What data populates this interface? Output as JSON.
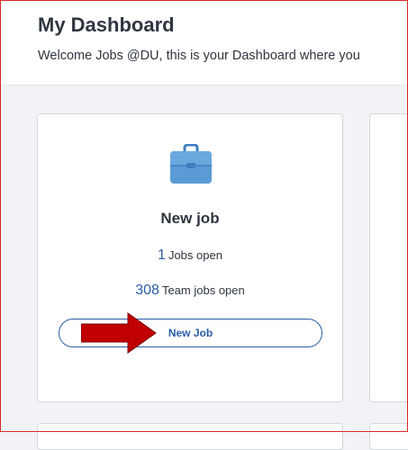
{
  "header": {
    "title": "My Dashboard",
    "subtitle": "Welcome Jobs @DU, this is your Dashboard where you"
  },
  "card": {
    "icon": "briefcase-icon",
    "title": "New job",
    "jobs_open_count": "1",
    "jobs_open_label": "Jobs open",
    "team_jobs_count": "308",
    "team_jobs_label": "Team jobs open",
    "button_label": "New Job"
  },
  "annotation": {
    "icon": "red-arrow-icon",
    "color": "#c00000"
  },
  "colors": {
    "accent": "#2a5da8",
    "briefcase": "#5b9bd5",
    "frame": "#d42a2a"
  }
}
